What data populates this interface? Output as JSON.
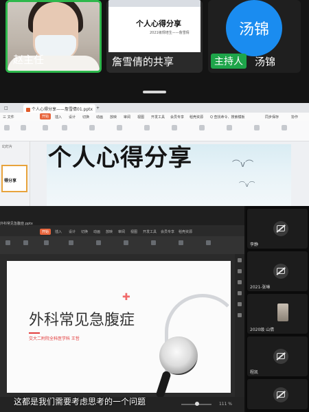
{
  "video_tiles": [
    {
      "name": "赵主任"
    },
    {
      "name": "詹雪倩的共享",
      "slide_title": "个人心得分享",
      "slide_sub": "2021级规培生——詹雪倩"
    },
    {
      "avatar_text": "汤锦",
      "badge": "主持人",
      "name": "汤锦"
    }
  ],
  "share1": {
    "tabs": [
      {
        "label": "□"
      },
      {
        "label": "个人心得分享——詹雪倩01.pptx"
      },
      {
        "label": "+"
      }
    ],
    "menu": [
      "三 文件",
      "开始",
      "插入",
      "设计",
      "切换",
      "动画",
      "放映",
      "审阅",
      "视图",
      "开发工具",
      "会员专享",
      "稻壳资源"
    ],
    "search_placeholder": "Q 查找命令、搜索模板",
    "sync": "同步保存",
    "collab": "协作",
    "panel_label": "幻灯片",
    "thumb1_text": "得分享",
    "slide_title": "个人心得分享"
  },
  "share2": {
    "file_tab": "外科常见急腹症.pptx",
    "menu": [
      "开始",
      "插入",
      "设计",
      "切换",
      "动画",
      "放映",
      "审阅",
      "视图",
      "开发工具",
      "会员专享",
      "稻壳资源"
    ],
    "slide_title": "外科常见急腹症",
    "slide_sub": "交大二附院全科医学科  王哲",
    "zoom": "111 %",
    "subtitle": "这都是我们需要考虑思考的一个问题"
  },
  "participants": [
    {
      "name": "李静",
      "video": "off"
    },
    {
      "name": "2021-张琳",
      "video": "off"
    },
    {
      "name": "2020级 山倩",
      "video": "on"
    },
    {
      "name": "程凯",
      "video": "off"
    },
    {
      "name": "",
      "video": "off"
    }
  ],
  "colors": {
    "accent_green": "#2db84c",
    "avatar_blue": "#1a8cf0",
    "wps_orange": "#e8643b"
  }
}
